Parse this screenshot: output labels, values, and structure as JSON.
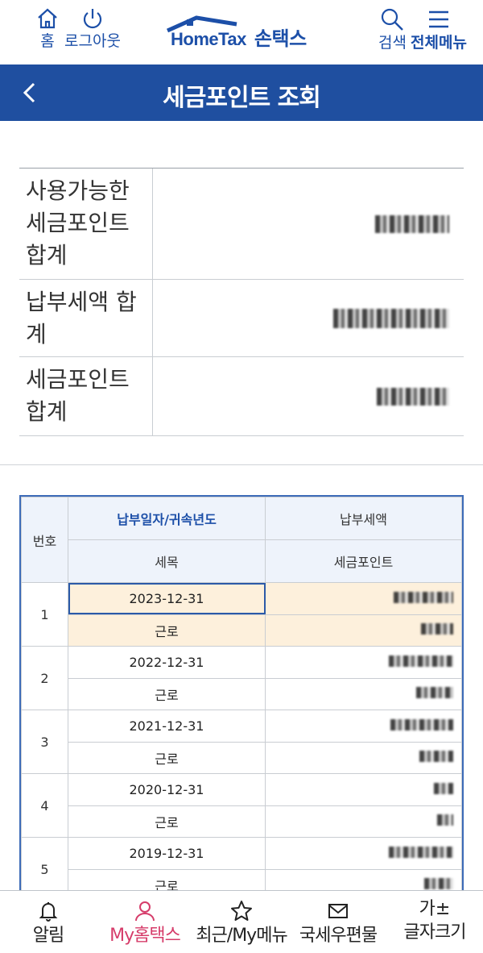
{
  "header": {
    "home_label": "홈",
    "logout_label": "로그아웃",
    "logo_text": "HomeTax",
    "logo_sub": "손택스",
    "search_label": "검색",
    "menu_label": "전체메뉴"
  },
  "title_bar": {
    "title": "세금포인트 조회"
  },
  "summary": {
    "rows": [
      {
        "label": "사용가능한 세금포인트 합계"
      },
      {
        "label": "납부세액 합계"
      },
      {
        "label": "세금포인트 합계"
      }
    ]
  },
  "table": {
    "headers": {
      "no": "번호",
      "date_year": "납부일자/귀속년도",
      "tax_amount": "납부세액",
      "tax_item": "세목",
      "tax_point": "세금포인트"
    },
    "rows": [
      {
        "no": "1",
        "date": "2023-12-31",
        "item": "근로"
      },
      {
        "no": "2",
        "date": "2022-12-31",
        "item": "근로"
      },
      {
        "no": "3",
        "date": "2021-12-31",
        "item": "근로"
      },
      {
        "no": "4",
        "date": "2020-12-31",
        "item": "근로"
      },
      {
        "no": "5",
        "date": "2019-12-31",
        "item": "근로"
      }
    ]
  },
  "bottom_nav": {
    "items": [
      {
        "label": "알림",
        "icon": "bell-icon"
      },
      {
        "label": "My홈택스",
        "icon": "person-icon"
      },
      {
        "label": "최근/My메뉴",
        "icon": "star-icon"
      },
      {
        "label": "국세우편물",
        "icon": "mail-icon"
      },
      {
        "label": "글자크기",
        "icon": "font-size-icon"
      }
    ],
    "font_size_glyph": "가±",
    "active_color": "#d63c6a"
  },
  "colors": {
    "brand": "#1f4fa0",
    "accent": "#d63c6a",
    "highlight_row": "#fdf0dc"
  }
}
